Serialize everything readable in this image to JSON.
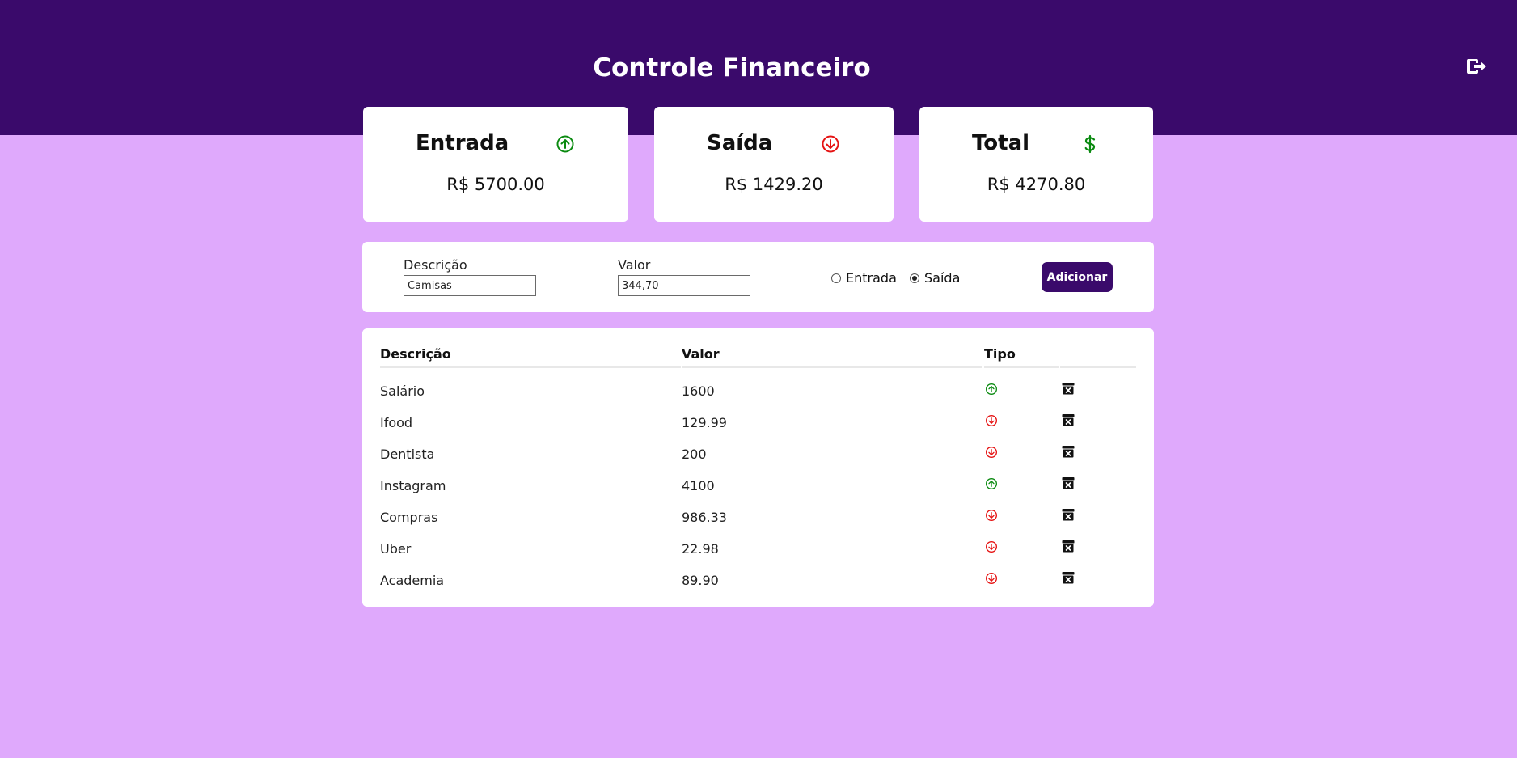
{
  "header": {
    "title": "Controle Financeiro",
    "logout_icon": "logout-icon"
  },
  "cards": {
    "entrada": {
      "title": "Entrada",
      "value": "R$ 5700.00",
      "icon": "arrow-up-circle-icon",
      "icon_color": "#0a8a10"
    },
    "saida": {
      "title": "Saída",
      "value": "R$ 1429.20",
      "icon": "arrow-down-circle-icon",
      "icon_color": "#e51212"
    },
    "total": {
      "title": "Total",
      "value": "R$ 4270.80",
      "icon": "dollar-icon",
      "icon_color": "#0a8a10"
    }
  },
  "form": {
    "descricao_label": "Descrição",
    "descricao_value": "Camisas",
    "valor_label": "Valor",
    "valor_value": "344,70",
    "radio_entrada_label": "Entrada",
    "radio_saida_label": "Saída",
    "selected": "Saída",
    "add_label": "Adicionar"
  },
  "table": {
    "headers": [
      "Descrição",
      "Valor",
      "Tipo"
    ],
    "rows": [
      {
        "descricao": "Salário",
        "valor": "1600",
        "tipo": "entrada"
      },
      {
        "descricao": "Ifood",
        "valor": "129.99",
        "tipo": "saida"
      },
      {
        "descricao": "Dentista",
        "valor": "200",
        "tipo": "saida"
      },
      {
        "descricao": "Instagram",
        "valor": "4100",
        "tipo": "entrada"
      },
      {
        "descricao": "Compras",
        "valor": "986.33",
        "tipo": "saida"
      },
      {
        "descricao": "Uber",
        "valor": "22.98",
        "tipo": "saida"
      },
      {
        "descricao": "Academia",
        "valor": "89.90",
        "tipo": "saida"
      }
    ]
  },
  "colors": {
    "header_bg": "#3a0a6b",
    "page_bg": "#dfa9fc",
    "entrada": "#0a8a10",
    "saida": "#e51212"
  }
}
